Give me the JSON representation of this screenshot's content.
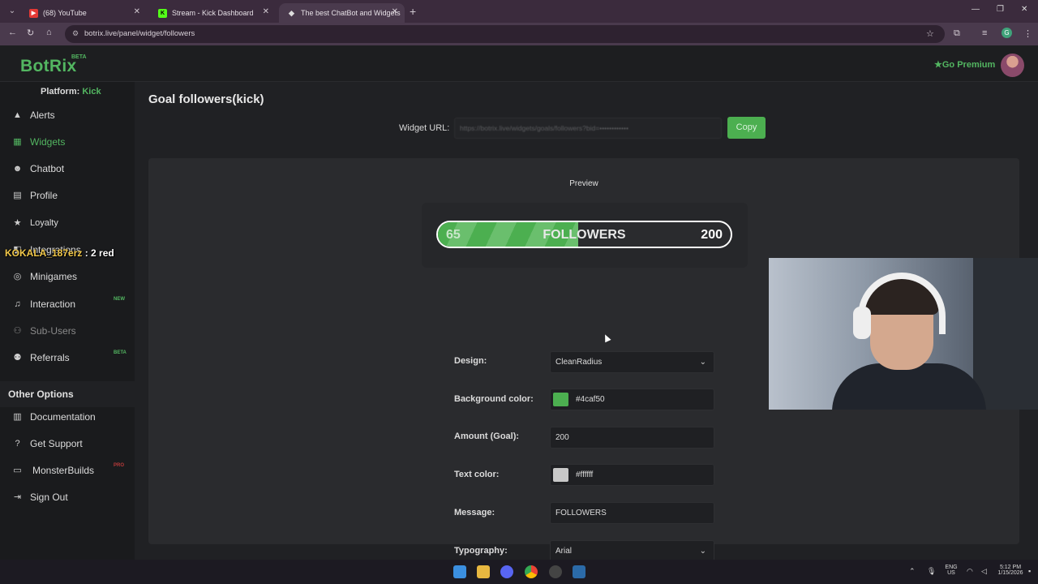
{
  "browser": {
    "tabs": [
      {
        "title": "(68) YouTube",
        "favicon_color": "#e53935"
      },
      {
        "title": "Stream - Kick Dashboard",
        "favicon_color": "#53fc18"
      },
      {
        "title": "The best ChatBot and Widgets",
        "favicon_color": "#c8c8c8"
      }
    ],
    "url": "botrix.live/panel/widget/followers"
  },
  "app": {
    "logo": "BotRix",
    "beta": "BETA",
    "premium": "Go Premium",
    "platform_label": "Platform:",
    "platform_value": "Kick"
  },
  "sidebar": {
    "items": [
      {
        "label": "Alerts",
        "icon": "warning-icon"
      },
      {
        "label": "Widgets",
        "icon": "grid-icon",
        "active": true
      },
      {
        "label": "Chatbot",
        "icon": "robot-icon"
      },
      {
        "label": "Profile",
        "icon": "id-card-icon"
      },
      {
        "label": "Loyalty",
        "icon": "star-icon"
      },
      {
        "label": "Integrations",
        "icon": "plug-icon"
      },
      {
        "label": "Minigames",
        "icon": "gamepad-icon"
      },
      {
        "label": "Interaction",
        "icon": "music-icon",
        "badge": "NEW"
      },
      {
        "label": "Sub-Users",
        "icon": "users-icon"
      },
      {
        "label": "Referrals",
        "icon": "people-icon",
        "badge": "BETA"
      }
    ],
    "other_options": "Other Options",
    "other_items": [
      {
        "label": "Documentation",
        "icon": "book-icon"
      },
      {
        "label": "Get Support",
        "icon": "question-icon"
      },
      {
        "label": "MonsterBuilds",
        "icon": "monitor-icon",
        "badge": "PRO"
      },
      {
        "label": "Sign Out",
        "icon": "signout-icon"
      }
    ]
  },
  "overlay": {
    "name": "KOKALA_187erz",
    "text": ": 2 red"
  },
  "main": {
    "title": "Goal followers(kick)",
    "widget_url_label": "Widget URL:",
    "widget_url_value": "https://botrix.live/widgets/goals/followers?bid=••••••••••••",
    "copy": "Copy",
    "preview_label": "Preview",
    "goal": {
      "current": "65",
      "message": "FOLLOWERS",
      "goal": "200",
      "progress": 0.48
    },
    "form": {
      "design_label": "Design:",
      "design_value": "CleanRadius",
      "bg_label": "Background color:",
      "bg_value": "#4caf50",
      "amount_label": "Amount (Goal):",
      "amount_value": "200",
      "text_color_label": "Text color:",
      "text_color_value": "#ffffff",
      "message_label": "Message:",
      "message_value": "FOLLOWERS",
      "typography_label": "Typography:",
      "typography_value": "Arial"
    }
  },
  "taskbar": {
    "lang1": "ENG",
    "lang2": "US",
    "time": "5:12 PM",
    "date": "1/15/2026"
  }
}
